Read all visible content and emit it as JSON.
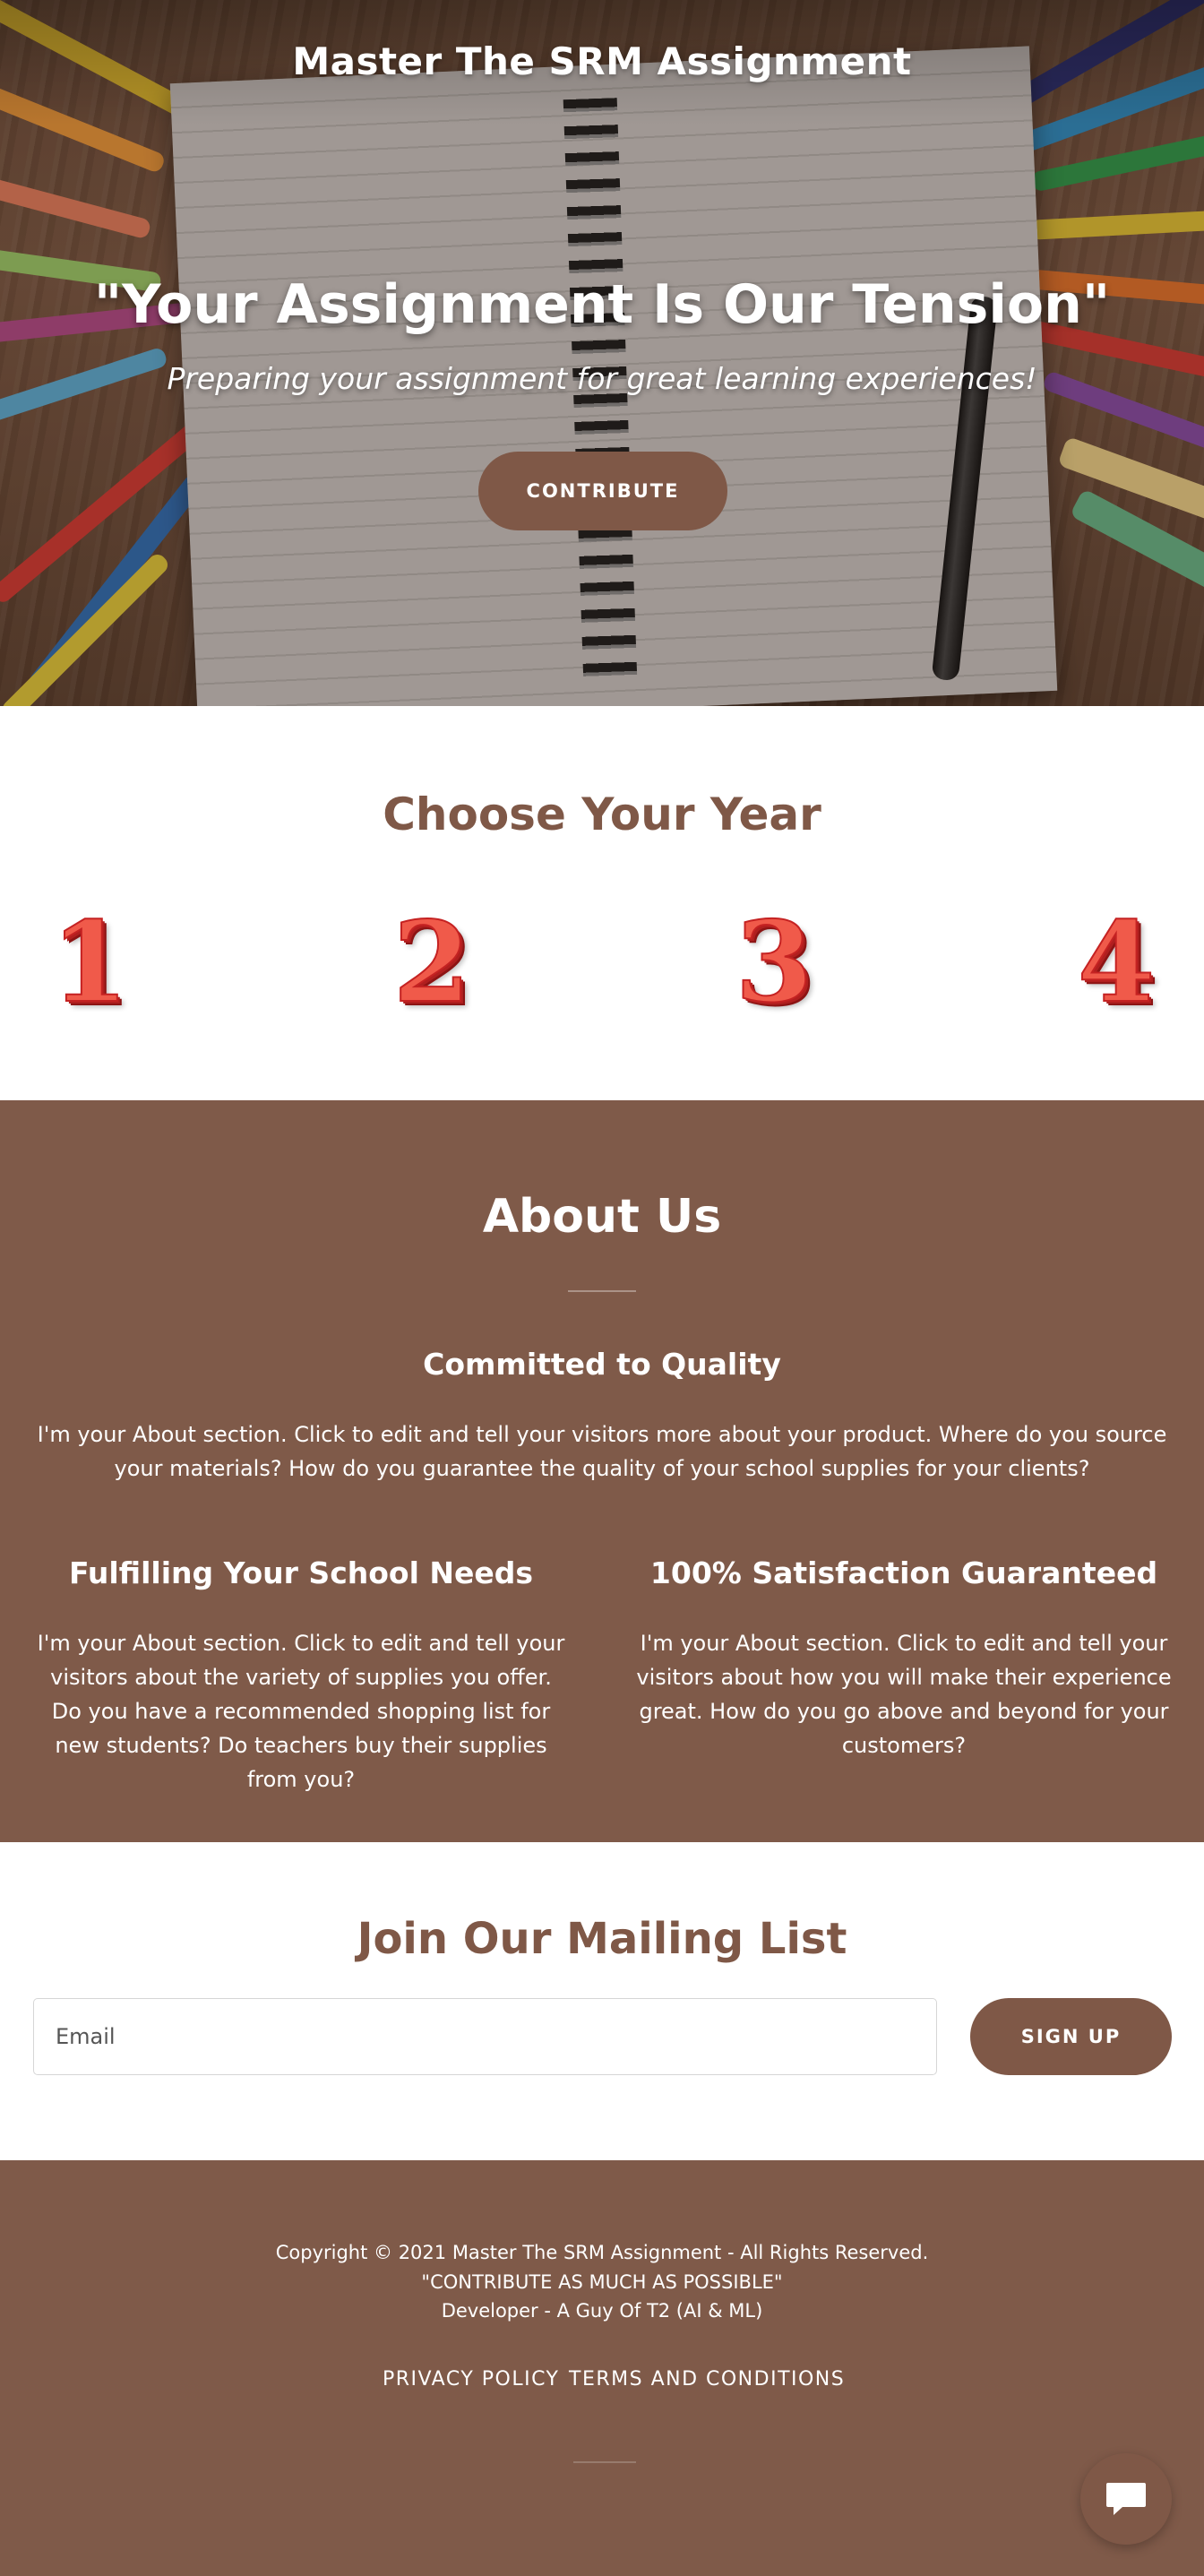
{
  "header": {
    "site_title": "Master The SRM Assignment"
  },
  "hero": {
    "heading": "\"Your Assignment Is Our Tension\"",
    "subheading": "Preparing your assignment for great learning experiences!",
    "cta_label": "CONTRIBUTE"
  },
  "years": {
    "title": "Choose Your Year",
    "items": [
      "1",
      "2",
      "3",
      "4"
    ]
  },
  "about": {
    "title": "About Us",
    "main_heading": "Committed to Quality",
    "main_text": "I'm your About section. Click to edit and tell your visitors more about your product. Where do you source your materials? How do you guarantee the quality of your school supplies for your clients?",
    "col1_heading": "Fulfilling Your School Needs",
    "col1_text": "I'm your About section. Click to edit and tell your visitors about the variety of supplies you offer. Do you have a recommended shopping list for new students? Do teachers buy their supplies from you?",
    "col2_heading": "100% Satisfaction Guaranteed",
    "col2_text": "I'm your About section. Click to edit and tell your visitors about how you will make their experience great. How do you go above and beyond for your customers?"
  },
  "mailing": {
    "title": "Join Our Mailing List",
    "email_placeholder": "Email",
    "signup_label": "SIGN UP"
  },
  "footer": {
    "copyright": "Copyright © 2021 Master The SRM Assignment - All Rights Reserved.",
    "tagline": "\"CONTRIBUTE AS MUCH AS POSSIBLE\"",
    "developer": "Developer - A Guy Of T2 (AI & ML)",
    "links": [
      "PRIVACY POLICY",
      "TERMS AND CONDITIONS"
    ]
  },
  "icons": {
    "chat": "chat-bubble-icon"
  },
  "colors": {
    "accent": "#7f5847",
    "section_bg": "#7f5a49",
    "year_number": "#f05a4a"
  }
}
